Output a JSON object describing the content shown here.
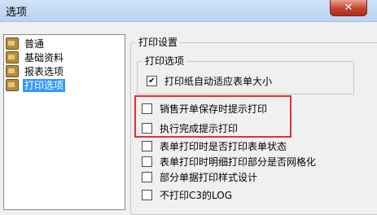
{
  "window": {
    "title": "选项",
    "close_glyph": "✕"
  },
  "tree": {
    "items": [
      {
        "label": "普通",
        "selected": false
      },
      {
        "label": "基础资料",
        "selected": false
      },
      {
        "label": "报表选项",
        "selected": false
      },
      {
        "label": "打印选项",
        "selected": true
      }
    ]
  },
  "print_settings": {
    "group_title": "打印设置",
    "print_options": {
      "group_title": "打印选项",
      "checkboxes": [
        {
          "label": "打印纸自动适应表单大小",
          "checked": true
        }
      ]
    },
    "checkboxes": [
      {
        "label": "销售开单保存时提示打印",
        "checked": false
      },
      {
        "label": "执行完成提示打印",
        "checked": false
      },
      {
        "label": "表单打印时是否打印表单状态",
        "checked": false
      },
      {
        "label": "表单打印时明细打印部分是否网格化",
        "checked": false
      },
      {
        "label": "部分单据打印样式设计",
        "checked": false
      },
      {
        "label": "不打印C3的LOG",
        "checked": false
      }
    ]
  },
  "colors": {
    "highlight": "#e53030",
    "selection": "#3399ff"
  }
}
